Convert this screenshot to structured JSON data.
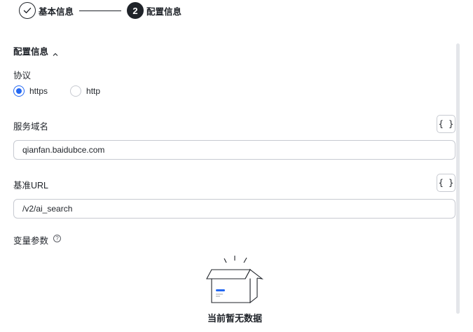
{
  "steps": [
    {
      "label": "基本信息",
      "status": "done"
    },
    {
      "number": "2",
      "label": "配置信息",
      "status": "active"
    }
  ],
  "section": {
    "title": "配置信息"
  },
  "protocol": {
    "label": "协议",
    "options": [
      {
        "label": "https",
        "checked": true
      },
      {
        "label": "http",
        "checked": false
      }
    ]
  },
  "domain": {
    "label": "服务域名",
    "value": "qianfan.baidubce.com",
    "brace": "{ }"
  },
  "base_url": {
    "label": "基准URL",
    "value": "/v2/ai_search",
    "brace": "{ }"
  },
  "variables": {
    "label": "变量参数",
    "help": "?",
    "empty_text": "当前暂无数据"
  },
  "colors": {
    "accent": "#2468f2",
    "text": "#1f2329",
    "border": "#c7cad1"
  },
  "icons": [
    "check-icon",
    "chevron-up-icon",
    "help-icon",
    "empty-box-icon"
  ]
}
